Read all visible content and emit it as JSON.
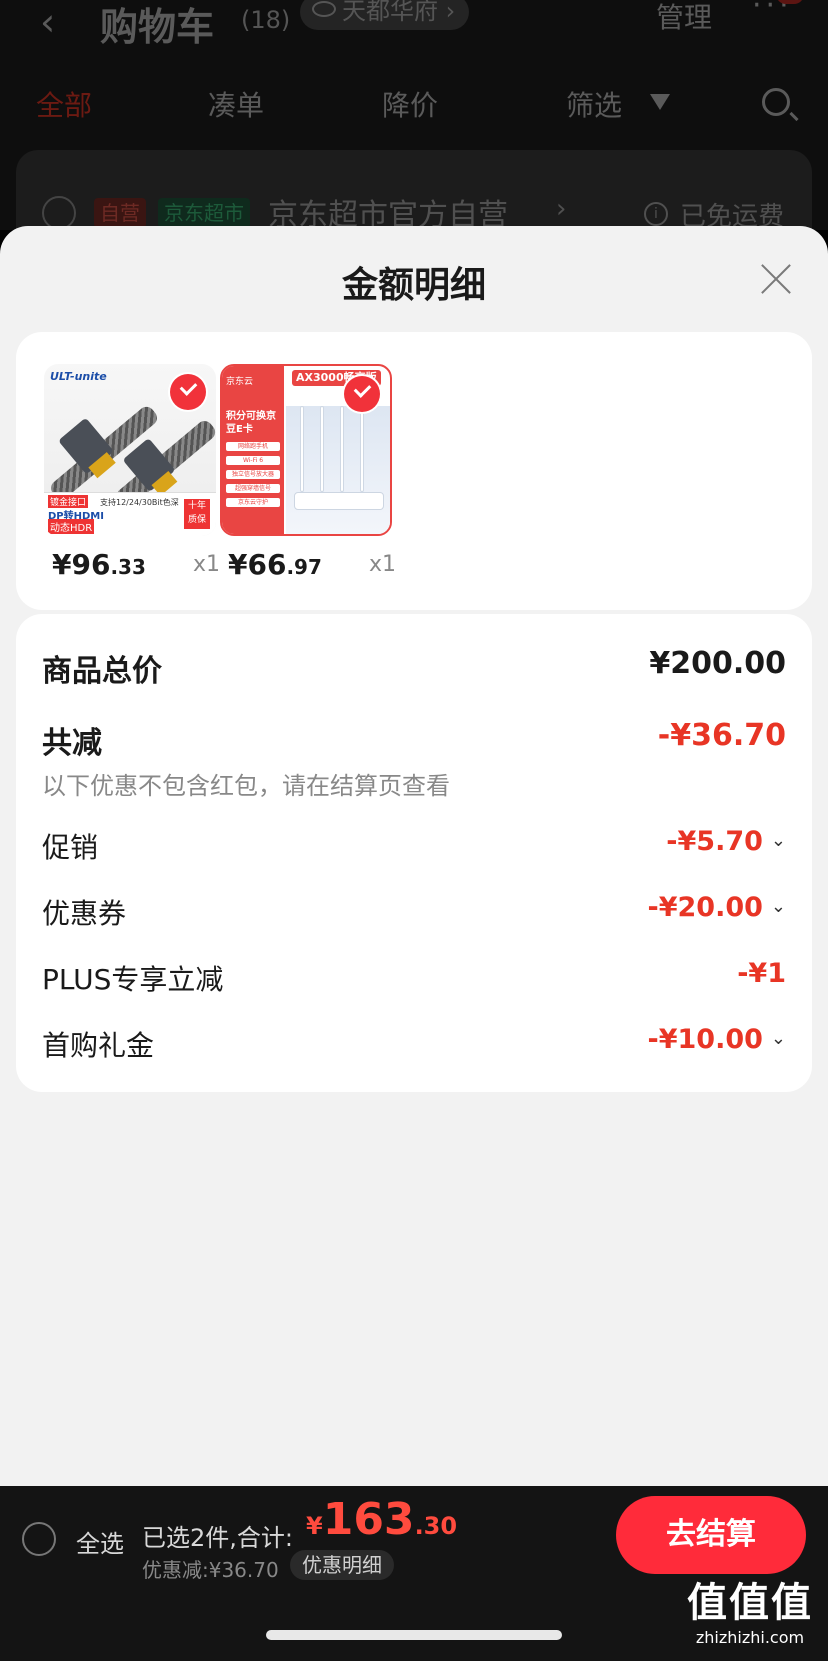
{
  "background": {
    "back_icon": "chevron-left-icon",
    "title": "购物车",
    "count": "(18)",
    "location": "天都华府",
    "location_chevron": "›",
    "manage": "管理",
    "more": "···",
    "tabs": [
      {
        "label": "全部",
        "active": true
      },
      {
        "label": "凑单",
        "active": false
      },
      {
        "label": "降价",
        "active": false
      },
      {
        "label": "筛选",
        "active": false
      }
    ],
    "store": {
      "tag_self": "自营",
      "tag_market": "京东超市",
      "name": "京东超市官方自营",
      "chevron": "›",
      "info_icon": "i",
      "shipping": "已免运费"
    }
  },
  "sheet": {
    "title": "金额明细",
    "products": [
      {
        "image": "hdmi-cable-image",
        "brand": "ULT-unite",
        "badge1": "镀金接口",
        "badge2": "DP转HDMI",
        "badge3": "动态HDR",
        "spec": "支持12/24/30Bit色深",
        "warranty": "十年质保",
        "price_int": "¥96",
        "price_dec": ".33",
        "qty": "x1"
      },
      {
        "image": "router-image",
        "logo": "京东云",
        "banner": "AX3000畅享版",
        "text": "积分可换京豆E卡",
        "chips": [
          "网络跑手机",
          "Wi-Fi 6",
          "独立信号放大器",
          "超强穿墙信号",
          "京东云守护"
        ],
        "price_int": "¥66",
        "price_dec": ".97",
        "qty": "x1"
      }
    ],
    "summary": {
      "total_label": "商品总价",
      "total_value": "¥200.00",
      "reduce_label": "共减",
      "reduce_value": "-¥36.70",
      "note": "以下优惠不包含红包，请在结算页查看",
      "items": [
        {
          "label": "促销",
          "value": "-¥5.70",
          "expandable": true
        },
        {
          "label": "优惠券",
          "value": "-¥20.00",
          "expandable": true
        },
        {
          "label": "PLUS专享立减",
          "value": "-¥1",
          "expandable": false
        },
        {
          "label": "首购礼金",
          "value": "-¥10.00",
          "expandable": true
        }
      ],
      "chevron": "⌄"
    }
  },
  "bottom_bar": {
    "select_all": "全选",
    "selected_text": "已选2件,合计:",
    "total_currency": "¥",
    "total_int": "163",
    "total_dec": ".30",
    "discount_text": "优惠减:¥36.70",
    "detail_label": "优惠明细",
    "checkout_label": "去结算"
  },
  "watermark": {
    "big": "值值值",
    "small": "zhizhizhi.com"
  },
  "colors": {
    "accent_red": "#e83525",
    "checkout_red": "#ff2b3a",
    "sheet_bg": "#f2f2f2"
  }
}
